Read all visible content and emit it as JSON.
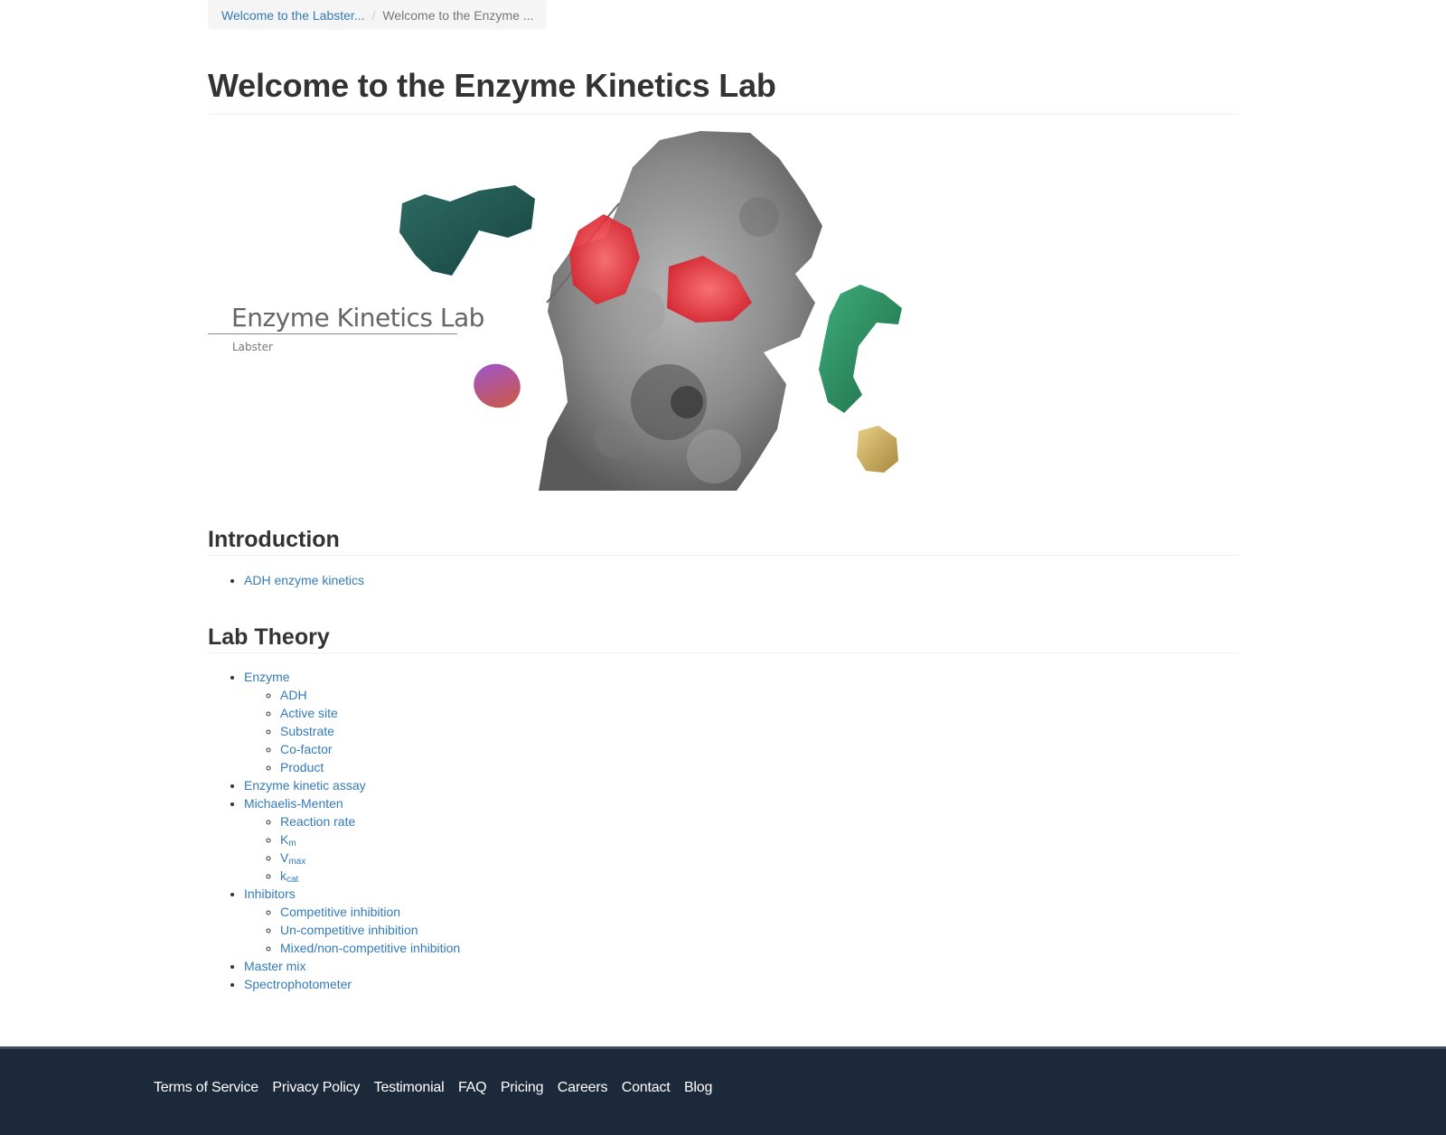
{
  "breadcrumb": {
    "items": [
      {
        "label": "Welcome to the Labster..."
      },
      {
        "label": "Welcome to the Enzyme ..."
      }
    ],
    "separator": "/"
  },
  "page": {
    "title": "Welcome to the Enzyme Kinetics Lab"
  },
  "hero": {
    "title": "Enzyme Kinetics Lab",
    "subtitle": "Labster"
  },
  "introduction": {
    "heading": "Introduction",
    "items": [
      {
        "label": "ADH enzyme kinetics"
      }
    ]
  },
  "lab_theory": {
    "heading": "Lab Theory",
    "enzyme": {
      "label": "Enzyme",
      "children": [
        "ADH",
        "Active site",
        "Substrate",
        "Co-factor",
        "Product"
      ]
    },
    "enzyme_kinetic_assay": "Enzyme kinetic assay",
    "michaelis_menten": {
      "label": "Michaelis-Menten",
      "reaction_rate": "Reaction rate",
      "km": {
        "base": "K",
        "sub": "m"
      },
      "vmax": {
        "base": "V",
        "sub": "max"
      },
      "kcat": {
        "base": "k",
        "sub": "cat"
      }
    },
    "inhibitors": {
      "label": "Inhibitors",
      "children": [
        "Competitive inhibition",
        "Un-competitive inhibition",
        "Mixed/non-competitive inhibition"
      ]
    },
    "master_mix": "Master mix",
    "spectrophotometer": "Spectrophotometer"
  },
  "footer": {
    "links": [
      "Terms of Service",
      "Privacy Policy",
      "Testimonial",
      "FAQ",
      "Pricing",
      "Careers",
      "Contact",
      "Blog"
    ]
  },
  "colors": {
    "link": "#337ab7",
    "footer_bg": "#1b293a",
    "protein_grey": "#8a8a8a",
    "active_site_red": "#e8343f"
  }
}
